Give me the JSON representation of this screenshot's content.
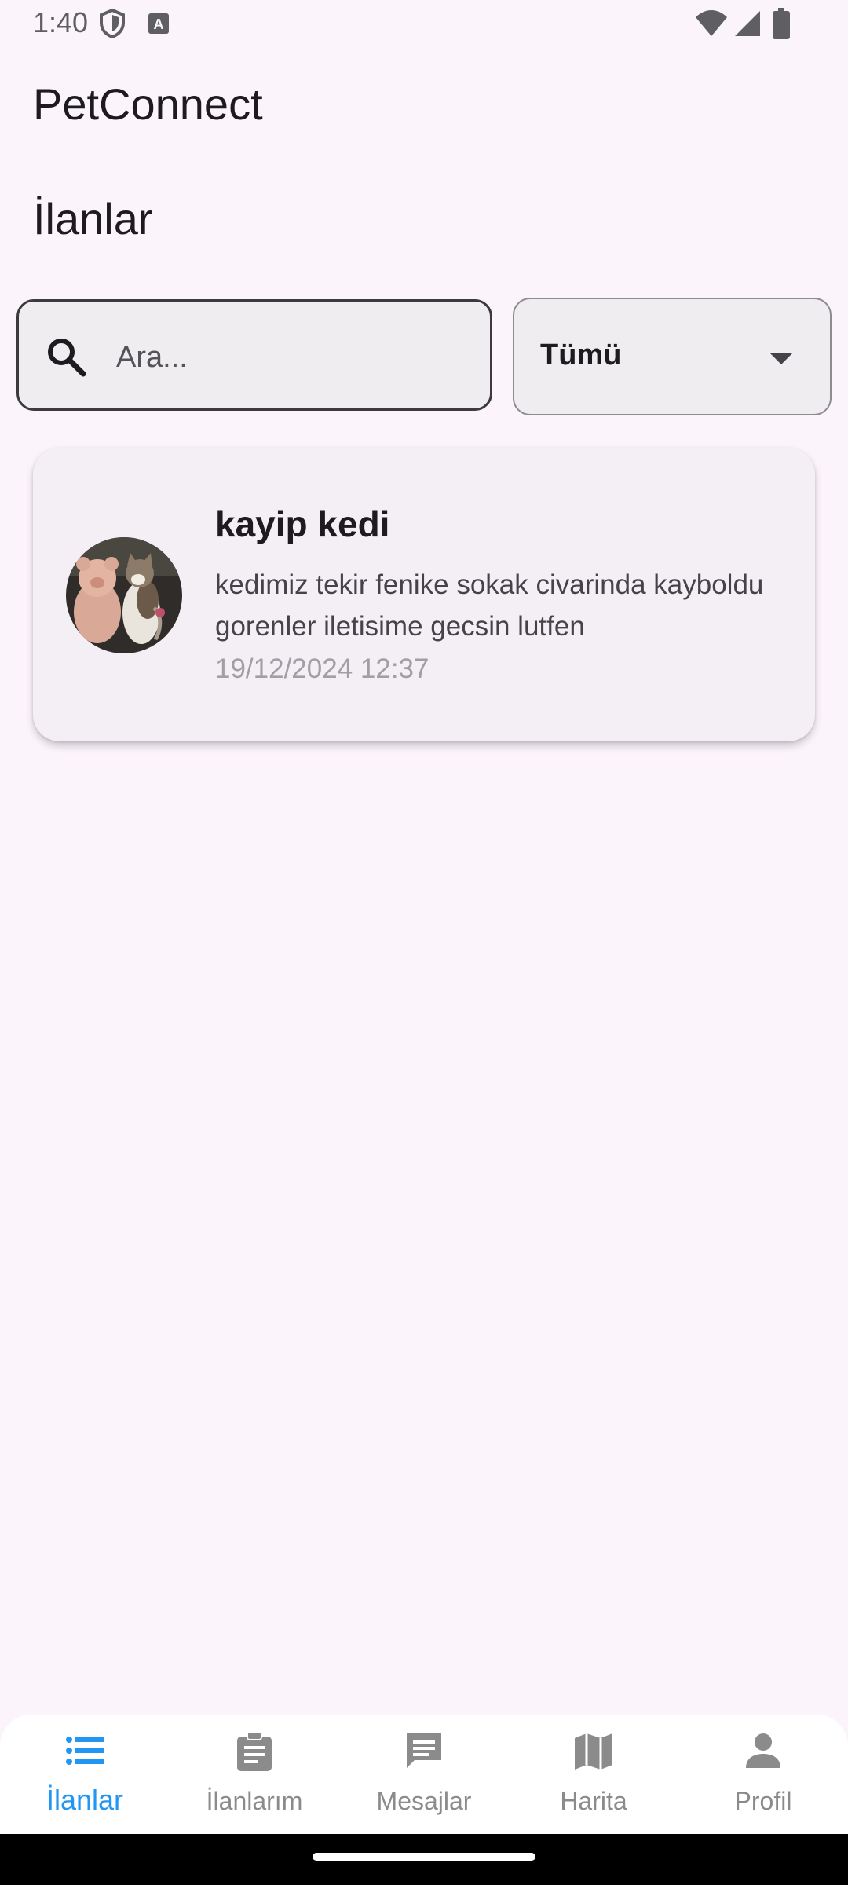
{
  "status_bar": {
    "time": "1:40"
  },
  "app": {
    "title": "PetConnect"
  },
  "section": {
    "title": "İlanlar"
  },
  "search": {
    "placeholder": "Ara...",
    "value": ""
  },
  "filter": {
    "selected": "Tümü"
  },
  "listings": [
    {
      "title": "kayip kedi",
      "description": "kedimiz tekir fenike sokak civarinda kayboldu gorenler iletisime gecsin lutfen",
      "date": "19/12/2024 12:37",
      "image_icon": "cat-with-teddy-bear-photo"
    }
  ],
  "bottom_nav": {
    "active_color": "#2196f3",
    "inactive_color": "#8b8b8b",
    "items": [
      {
        "label": "İlanlar",
        "icon": "list-icon",
        "active": true
      },
      {
        "label": "İlanlarım",
        "icon": "clipboard-icon",
        "active": false
      },
      {
        "label": "Mesajlar",
        "icon": "message-icon",
        "active": false
      },
      {
        "label": "Harita",
        "icon": "map-icon",
        "active": false
      },
      {
        "label": "Profil",
        "icon": "person-icon",
        "active": false
      }
    ]
  },
  "colors": {
    "background": "#fcf4fb",
    "card": "#f4eff4",
    "accent": "#2196f3"
  }
}
